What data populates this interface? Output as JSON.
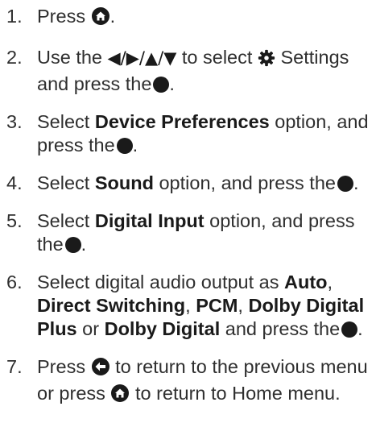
{
  "steps": [
    {
      "num": "1.",
      "t1": "Press",
      "t2": "."
    },
    {
      "num": "2.",
      "t1": "Use the",
      "arrows": "◀/▶/▲/▼",
      "t2": "to select",
      "t3": "Settings and press the",
      "t4": "."
    },
    {
      "num": "3.",
      "t1": "Select",
      "b1": "Device Preferences",
      "t2": "option, and press the",
      "t3": "."
    },
    {
      "num": "4.",
      "t1": "Select",
      "b1": "Sound",
      "t2": "option, and press the",
      "t3": "."
    },
    {
      "num": "5.",
      "t1": "Select",
      "b1": "Digital Input",
      "t2": "option, and press the",
      "t3": "."
    },
    {
      "num": "6.",
      "t1": "Select digital audio output as",
      "b1": "Auto",
      "c1": ",",
      "b2": "Direct Switching",
      "c2": ",",
      "b3": "PCM",
      "c3": ",",
      "b4": "Dolby Digital Plus",
      "t2": "or",
      "b5": "Dolby Digital",
      "t3": "and press the",
      "t4": "."
    },
    {
      "num": "7.",
      "t1": "Press",
      "t2": "to return to the previous menu or press",
      "t3": "to return to Home menu."
    }
  ]
}
